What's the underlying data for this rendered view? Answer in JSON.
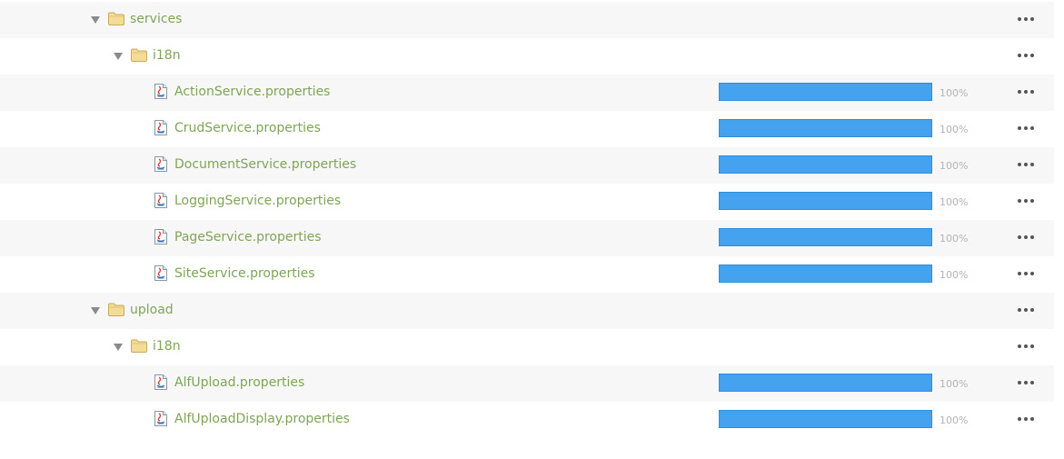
{
  "colors": {
    "name_text": "#7fa556",
    "bar_fill": "#45a2ee",
    "percent_text": "#b3b3b3",
    "row_alt_background": "#f7f7f7"
  },
  "rows": [
    {
      "type": "folder",
      "level": 1,
      "expanded": true,
      "name": "services"
    },
    {
      "type": "folder",
      "level": 2,
      "expanded": true,
      "name": "i18n"
    },
    {
      "type": "file",
      "level": 3,
      "name": "ActionService.properties",
      "progress": 100,
      "progress_label": "100%"
    },
    {
      "type": "file",
      "level": 3,
      "name": "CrudService.properties",
      "progress": 100,
      "progress_label": "100%"
    },
    {
      "type": "file",
      "level": 3,
      "name": "DocumentService.properties",
      "progress": 100,
      "progress_label": "100%"
    },
    {
      "type": "file",
      "level": 3,
      "name": "LoggingService.properties",
      "progress": 100,
      "progress_label": "100%"
    },
    {
      "type": "file",
      "level": 3,
      "name": "PageService.properties",
      "progress": 100,
      "progress_label": "100%"
    },
    {
      "type": "file",
      "level": 3,
      "name": "SiteService.properties",
      "progress": 100,
      "progress_label": "100%"
    },
    {
      "type": "folder",
      "level": 1,
      "expanded": true,
      "name": "upload"
    },
    {
      "type": "folder",
      "level": 2,
      "expanded": true,
      "name": "i18n"
    },
    {
      "type": "file",
      "level": 3,
      "name": "AlfUpload.properties",
      "progress": 100,
      "progress_label": "100%"
    },
    {
      "type": "file",
      "level": 3,
      "name": "AlfUploadDisplay.properties",
      "progress": 100,
      "progress_label": "100%"
    }
  ]
}
